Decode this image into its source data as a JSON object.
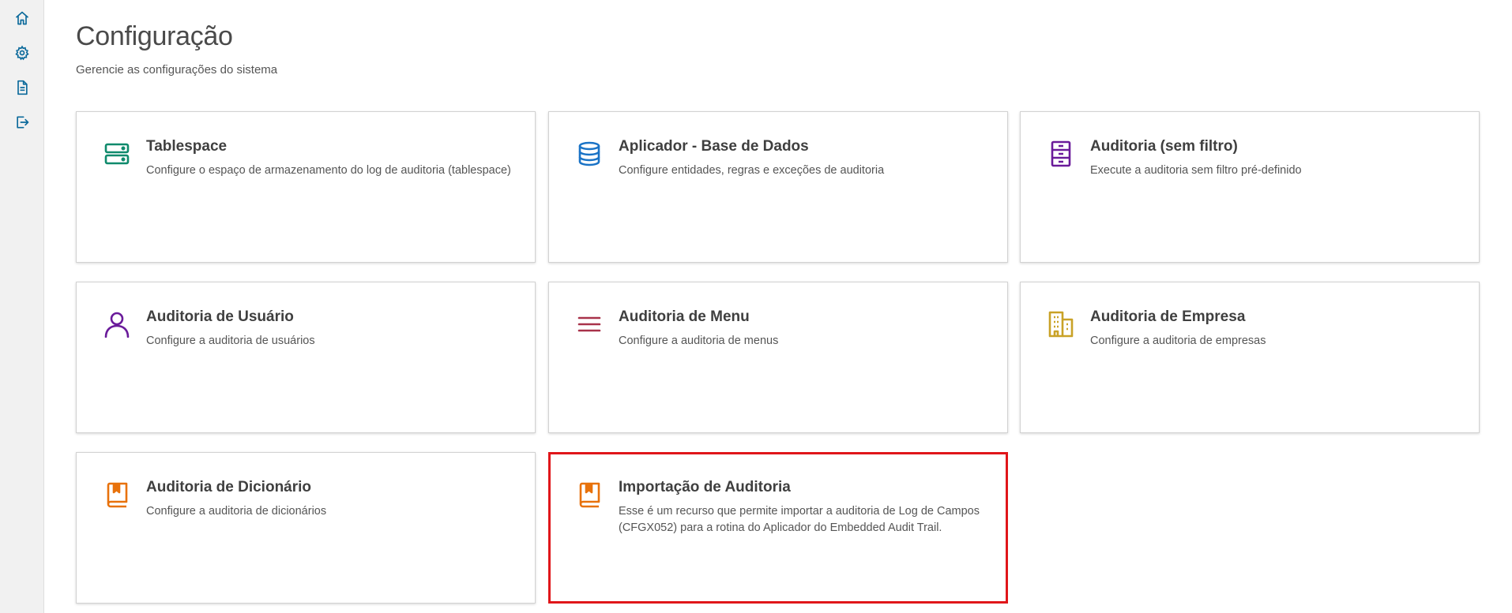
{
  "sidebar": {
    "items": [
      {
        "icon": "home-icon"
      },
      {
        "icon": "gear-icon"
      },
      {
        "icon": "document-icon"
      },
      {
        "icon": "logout-icon"
      }
    ],
    "icon_color": "#0c6a9b"
  },
  "header": {
    "title": "Configuração",
    "subtitle": "Gerencie as configurações do sistema"
  },
  "cards": [
    {
      "title": "Tablespace",
      "description": "Configure o espaço de armazenamento do log de auditoria (tablespace)",
      "icon": "server-icon",
      "color": "#0f8a6c"
    },
    {
      "title": "Aplicador - Base de Dados",
      "description": "Configure entidades, regras e exceções de auditoria",
      "icon": "database-icon",
      "color": "#1a73c6"
    },
    {
      "title": "Auditoria (sem filtro)",
      "description": "Execute a auditoria sem filtro pré-definido",
      "icon": "file-cabinet-icon",
      "color": "#6a1b9a"
    },
    {
      "title": "Auditoria de Usuário",
      "description": "Configure a auditoria de usuários",
      "icon": "user-icon",
      "color": "#6a1b9a"
    },
    {
      "title": "Auditoria de Menu",
      "description": "Configure a auditoria de menus",
      "icon": "menu-icon",
      "color": "#a8324a"
    },
    {
      "title": "Auditoria de Empresa",
      "description": "Configure a auditoria de empresas",
      "icon": "building-icon",
      "color": "#c9a227"
    },
    {
      "title": "Auditoria de Dicionário",
      "description": "Configure a auditoria de dicionários",
      "icon": "book-icon",
      "color": "#e8720c"
    },
    {
      "title": "Importação de Auditoria",
      "description": "Esse é um recurso que permite importar a auditoria de Log de Campos (CFGX052) para a rotina do Aplicador do Embedded Audit Trail.",
      "icon": "book-icon",
      "color": "#e8720c",
      "selected": true
    }
  ],
  "selection_color": "#e0161a"
}
